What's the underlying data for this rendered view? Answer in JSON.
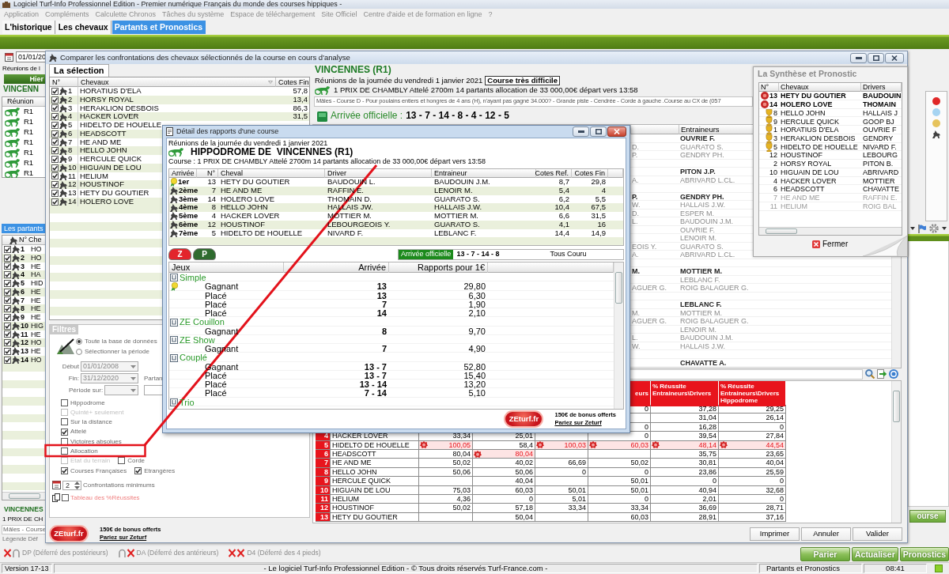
{
  "app": {
    "title": "Logiciel Turf-Info Professionnel Edition - Premier numérique Français du monde des courses hippiques -",
    "menu": [
      "Application",
      "Compléments",
      "Calculette Chronos",
      "Tâches du système",
      "Espace de téléchargement",
      "Site Officiel",
      "Centre d'aide et de formation en ligne",
      "?"
    ],
    "tabs": [
      {
        "label": "L'historique",
        "selected": false
      },
      {
        "label": "Les chevaux",
        "selected": false
      },
      {
        "label": "Partants et Pronostics",
        "selected": true
      }
    ]
  },
  "left_panel": {
    "date": "01/01/20",
    "meetings_label": "Réunions de l",
    "day_button": "Hier",
    "venue": "VINCENN",
    "meetings_column": "Réunion",
    "meetings": [
      "R1",
      "R1",
      "R1",
      "R1",
      "R1",
      "R1",
      "R1"
    ],
    "runners_tab": "Les partants",
    "runners_columns": [
      "N°",
      "Che"
    ],
    "runners": [
      {
        "number": "1",
        "name": "HO",
        "checked": true
      },
      {
        "number": "2",
        "name": "HO",
        "checked": true
      },
      {
        "number": "3",
        "name": "HE",
        "checked": true
      },
      {
        "number": "4",
        "name": "HA",
        "checked": true
      },
      {
        "number": "5",
        "name": "HID",
        "checked": true
      },
      {
        "number": "6",
        "name": "HE",
        "checked": true
      },
      {
        "number": "7",
        "name": "HE",
        "checked": true
      },
      {
        "number": "8",
        "name": "HE",
        "checked": true
      },
      {
        "number": "9",
        "name": "HE",
        "checked": true
      },
      {
        "number": "10",
        "name": "HIG",
        "checked": true
      },
      {
        "number": "11",
        "name": "HE",
        "checked": true
      },
      {
        "number": "12",
        "name": "HO",
        "checked": true
      },
      {
        "number": "13",
        "name": "HE",
        "checked": true
      },
      {
        "number": "14",
        "name": "HO",
        "checked": true
      }
    ],
    "race_venue": "VINCENNES",
    "race_title": "1 PRIX DE CH",
    "race_conditions": "Mâles - Course",
    "legend_title": "Légende Déf",
    "legend": [
      {
        "kind": "hind",
        "label": "DP (Déferré des postérieurs)"
      },
      {
        "kind": "front",
        "label": "DA (Déferré des antérieurs)"
      },
      {
        "kind": "all",
        "label": "D4 (Déferré des 4 pieds)"
      }
    ]
  },
  "right_strip": {
    "indicators": [
      {
        "color": "#e02828"
      },
      {
        "color": "#a6d4f2"
      },
      {
        "color": "#e6c35c"
      }
    ],
    "side_button": "ourse",
    "actions": [
      "Parier",
      "Actualiser",
      "Pronostics"
    ]
  },
  "status_bar": {
    "version": "Version 17-13",
    "copyright": "- Le logiciel Turf-Info Professionnel Edition - © Tous droits réservés Turf-France.com -",
    "section": "Partants et Pronostics",
    "time": "08:41"
  },
  "compare_window": {
    "title": "Comparer les confrontations des chevaux sélectionnés de la course en cours d'analyse",
    "selection_tab": "La sélection",
    "selection_columns": [
      "N°",
      "Chevaux",
      "Cotes Fin"
    ],
    "selection": [
      {
        "number": "1",
        "name": "HORATIUS D'ELA",
        "odds": "57,8",
        "checked": true
      },
      {
        "number": "2",
        "name": "HORSY ROYAL",
        "odds": "13,4",
        "checked": true
      },
      {
        "number": "3",
        "name": "HERAKLION DESBOIS",
        "odds": "86,3",
        "checked": true
      },
      {
        "number": "4",
        "name": "HACKER LOVER",
        "odds": "31,5",
        "checked": true
      },
      {
        "number": "5",
        "name": "HIDELTO DE HOUELLE",
        "checked": true
      },
      {
        "number": "6",
        "name": "HEADSCOTT",
        "checked": true
      },
      {
        "number": "7",
        "name": "HE AND ME",
        "checked": true
      },
      {
        "number": "8",
        "name": "HELLO JOHN",
        "checked": true
      },
      {
        "number": "9",
        "name": "HERCULE QUICK",
        "checked": true
      },
      {
        "number": "10",
        "name": "HIGUAIN DE LOU",
        "checked": true
      },
      {
        "number": "11",
        "name": "HELIUM",
        "checked": true
      },
      {
        "number": "12",
        "name": "HOUSTINOF",
        "checked": true
      },
      {
        "number": "13",
        "name": "HETY DU GOUTIER",
        "checked": true
      },
      {
        "number": "14",
        "name": "HOLERO LOVE",
        "checked": true
      }
    ],
    "filters": {
      "title": "Filtres",
      "scope": [
        {
          "label": "Toute la base de données",
          "selected": true
        },
        {
          "label": "Sélectionner la période",
          "selected": false
        }
      ],
      "start_label": "Début",
      "start": "01/01/2008",
      "end_label": "Fin:",
      "end": "31/12/2020",
      "side_label": "Partan",
      "period_label": "Période sur:",
      "option_rows": [
        [
          {
            "label": "Hippodrome",
            "checked": false,
            "disabled": false
          }
        ],
        [
          {
            "label": "Quinté+ seulement",
            "checked": false,
            "disabled": true
          }
        ],
        [
          {
            "label": "Sur la distance",
            "checked": false,
            "disabled": false
          }
        ],
        [
          {
            "label": "Attelé",
            "checked": true,
            "disabled": false
          }
        ],
        [
          {
            "label": "Victoires absolues",
            "checked": false,
            "disabled": false
          }
        ],
        [
          {
            "label": "Allocation",
            "checked": false,
            "disabled": false
          }
        ],
        [
          {
            "label": "Etat du terrain",
            "checked": false,
            "disabled": true
          },
          {
            "label": "Corde",
            "checked": false,
            "disabled": false
          }
        ],
        [
          {
            "label": "Courses Françaises",
            "checked": true,
            "disabled": false
          },
          {
            "label": "Etrangères",
            "checked": true,
            "disabled": false
          }
        ]
      ],
      "min_count": "2",
      "min_label": "Confrontations minimums",
      "table_option": {
        "label": "Tableau des %Réussites",
        "checked": false
      }
    },
    "race": {
      "venue": "VINCENNES (R1)",
      "date_line": "Réunions de la journée du vendredi 1 janvier 2021",
      "difficulty": "Course très difficile",
      "title": "1 PRIX DE CHAMBLY Attelé 2700m 14 partants allocation de 33 000,00€ départ vers 13:58",
      "conditions": "Mâles - Course D - Pour poulains entiers et hongres de 4 ans (H), n'ayant pas gagné 34.000? - Grande piste - Cendrée - Corde à gauche .Course au CX de (057",
      "result_label": "Arrivée officielle :",
      "result": "13 - 7 - 14 - 8 - 4 - 12 - 5"
    },
    "trainers_column": "Entraineurs",
    "trainers": [
      {
        "kind": "lead",
        "trainer": "OUVRIE F."
      },
      {
        "kind": "member",
        "driver": "D.",
        "trainer": "GUARATO S."
      },
      {
        "kind": "member",
        "driver": "P.",
        "trainer": "GENDRY PH."
      },
      {
        "kind": "spacer"
      },
      {
        "kind": "lead",
        "trainer": "PITON J.P."
      },
      {
        "kind": "member",
        "driver": "A.",
        "trainer": "ABRIVARD L.CL."
      },
      {
        "kind": "spacer"
      },
      {
        "kind": "lead",
        "driver": "P.",
        "trainer": "GENDRY PH."
      },
      {
        "kind": "member",
        "driver": "W.",
        "trainer": "HALLAIS J.W."
      },
      {
        "kind": "member",
        "driver": "D.",
        "trainer": "ESPER M."
      },
      {
        "kind": "member",
        "driver": "L.",
        "trainer": "BAUDOUIN J.M."
      },
      {
        "kind": "member",
        "trainer": "OUVRIE F."
      },
      {
        "kind": "member",
        "trainer": "LENOIR M."
      },
      {
        "kind": "member",
        "driver": "EOIS Y.",
        "trainer": "GUARATO S."
      },
      {
        "kind": "member",
        "driver": "A.",
        "trainer": "ABRIVARD L.CL."
      },
      {
        "kind": "spacer"
      },
      {
        "kind": "lead",
        "driver": "M.",
        "trainer": "MOTTIER M."
      },
      {
        "kind": "member",
        "trainer": "LEBLANC F."
      },
      {
        "kind": "member",
        "driver": "AGUER G.",
        "trainer": "ROIG BALAGUER G."
      },
      {
        "kind": "spacer"
      },
      {
        "kind": "lead",
        "trainer": "LEBLANC F."
      },
      {
        "kind": "member",
        "driver": "M.",
        "trainer": "MOTTIER M."
      },
      {
        "kind": "member",
        "driver": "AGUER G.",
        "trainer": "ROIG BALAGUER G."
      },
      {
        "kind": "member",
        "trainer": "LENOIR M."
      },
      {
        "kind": "member",
        "driver": "L.",
        "trainer": "BAUDOUIN J.M."
      },
      {
        "kind": "member",
        "driver": "W.",
        "trainer": "HALLAIS J.W."
      },
      {
        "kind": "spacer"
      },
      {
        "kind": "lead",
        "trainer": "CHAVATTE A."
      }
    ],
    "stats_columns": [
      "eurs",
      "% Réussite Entraineurs\\Drivers",
      "% Réussite Entraineurs\\Drivers Hippodrome"
    ],
    "stats": [
      {
        "cells": [
          {
            "text": "0",
            "flagged": false
          },
          {
            "text": "37,28",
            "flagged": false
          },
          {
            "text": "29,25",
            "flagged": false
          }
        ]
      },
      {
        "cells": [
          {
            "flagged": false
          },
          {
            "text": "31,04",
            "flagged": false
          },
          {
            "text": "26,14",
            "flagged": false
          }
        ]
      },
      {
        "cells": [
          {
            "text": "0",
            "flagged": false
          },
          {
            "text": "16,28",
            "flagged": false
          },
          {
            "text": "0",
            "flagged": false
          }
        ]
      },
      {
        "number": "4",
        "name": "HACKER LOVER",
        "cells": [
          {
            "text": "33,34",
            "flagged": false
          },
          {
            "text": "25,01",
            "flagged": false
          },
          {
            "flagged": false
          },
          {
            "text": "0",
            "flagged": false
          },
          {
            "text": "39,54",
            "flagged": false
          },
          {
            "text": "27,84",
            "flagged": false
          }
        ]
      },
      {
        "number": "5",
        "name": "HIDELTO DE HOUELLE",
        "cells": [
          {
            "text": "100,05",
            "flagged": true
          },
          {
            "text": "58,4",
            "flagged": false
          },
          {
            "text": "100,03",
            "flagged": true
          },
          {
            "text": "60,03",
            "flagged": true
          },
          {
            "text": "48,14",
            "flagged": true
          },
          {
            "text": "44,54",
            "flagged": true
          }
        ]
      },
      {
        "number": "6",
        "name": "HEADSCOTT",
        "cells": [
          {
            "text": "80,04",
            "flagged": false
          },
          {
            "text": "80,04",
            "flagged": true
          },
          {
            "flagged": false
          },
          {
            "flagged": false
          },
          {
            "text": "35,75",
            "flagged": false
          },
          {
            "text": "23,65",
            "flagged": false
          }
        ]
      },
      {
        "number": "7",
        "name": "HE AND ME",
        "cells": [
          {
            "text": "50,02",
            "flagged": false
          },
          {
            "text": "40,02",
            "flagged": false
          },
          {
            "text": "66,69",
            "flagged": false
          },
          {
            "text": "50,02",
            "flagged": false
          },
          {
            "text": "30,81",
            "flagged": false
          },
          {
            "text": "40,04",
            "flagged": false
          }
        ]
      },
      {
        "number": "8",
        "name": "HELLO JOHN",
        "cells": [
          {
            "text": "50,06",
            "flagged": false
          },
          {
            "text": "50,06",
            "flagged": false
          },
          {
            "text": "0",
            "flagged": false
          },
          {
            "text": "0",
            "flagged": false
          },
          {
            "text": "23,86",
            "flagged": false
          },
          {
            "text": "25,59",
            "flagged": false
          }
        ]
      },
      {
        "number": "9",
        "name": "HERCULE QUICK",
        "cells": [
          {
            "flagged": false
          },
          {
            "text": "40,04",
            "flagged": false
          },
          {
            "flagged": false
          },
          {
            "text": "50,01",
            "flagged": false
          },
          {
            "text": "0",
            "flagged": false
          },
          {
            "text": "0",
            "flagged": false
          }
        ]
      },
      {
        "number": "10",
        "name": "HIGUAIN DE LOU",
        "cells": [
          {
            "text": "75,03",
            "flagged": false
          },
          {
            "text": "60,03",
            "flagged": false
          },
          {
            "text": "50,01",
            "flagged": false
          },
          {
            "text": "50,01",
            "flagged": false
          },
          {
            "text": "40,94",
            "flagged": false
          },
          {
            "text": "32,68",
            "flagged": false
          }
        ]
      },
      {
        "number": "11",
        "name": "HELIUM",
        "cells": [
          {
            "text": "4,36",
            "flagged": false
          },
          {
            "text": "0",
            "flagged": false
          },
          {
            "text": "5,01",
            "flagged": false
          },
          {
            "text": "0",
            "flagged": false
          },
          {
            "text": "2,01",
            "flagged": false
          },
          {
            "text": "0",
            "flagged": false
          }
        ]
      },
      {
        "number": "12",
        "name": "HOUSTINOF",
        "cells": [
          {
            "text": "50,02",
            "flagged": false
          },
          {
            "text": "57,18",
            "flagged": false
          },
          {
            "text": "33,34",
            "flagged": false
          },
          {
            "text": "33,34",
            "flagged": false
          },
          {
            "text": "36,69",
            "flagged": false
          },
          {
            "text": "28,71",
            "flagged": false
          }
        ]
      },
      {
        "number": "13",
        "name": "HETY DU GOUTIER",
        "cells": [
          {
            "flagged": false
          },
          {
            "text": "50,04",
            "flagged": false
          },
          {
            "flagged": false
          },
          {
            "text": "60,03",
            "flagged": false
          },
          {
            "text": "28,91",
            "flagged": false
          },
          {
            "text": "37,16",
            "flagged": false
          }
        ]
      }
    ],
    "ad": {
      "logo": "ZEturf.fr",
      "offer": "150€ de bonus offerts",
      "link": "Pariez sur Zeturf"
    },
    "buttons": [
      "Imprimer",
      "Annuler",
      "Valider"
    ]
  },
  "detail_window": {
    "title": "Détail des rapports d'une course",
    "date_line": "Réunions de la journée du vendredi 1 janvier 2021",
    "venue": "HIPPODROME DE  VINCENNES (R1)",
    "course": "Course : 1 PRIX DE CHAMBLY Attelé 2700m 14 partants allocation de 33 000,00€ départ vers 13:58",
    "columns": [
      "Arrivée",
      "N°",
      "Cheval",
      "Driver",
      "Entraineur",
      "Cotes Ref.",
      "Cotes Fin"
    ],
    "finishers": [
      {
        "place": "1er",
        "kind": "winner",
        "number": "13",
        "horse": "HETY DU GOUTIER",
        "driver": "BAUDOUIN L.",
        "trainer": "BAUDOUIN J.M.",
        "odds_ref": "8,7",
        "odds_final": "29,8"
      },
      {
        "place": "2ème",
        "kind": "placed",
        "number": "7",
        "horse": "HE AND ME",
        "driver": "RAFFIN E.",
        "trainer": "LENOIR M.",
        "odds_ref": "5,4",
        "odds_final": "4"
      },
      {
        "place": "3ème",
        "kind": "placed",
        "number": "14",
        "horse": "HOLERO LOVE",
        "driver": "THOMAIN D.",
        "trainer": "GUARATO S.",
        "odds_ref": "6,2",
        "odds_final": "5,5"
      },
      {
        "place": "4ème",
        "kind": "placed",
        "number": "8",
        "horse": "HELLO JOHN",
        "driver": "HALLAIS JW.",
        "trainer": "HALLAIS J.W.",
        "odds_ref": "10,4",
        "odds_final": "67,5"
      },
      {
        "place": "5ème",
        "kind": "placed",
        "number": "4",
        "horse": "HACKER LOVER",
        "driver": "MOTTIER M.",
        "trainer": "MOTTIER M.",
        "odds_ref": "6,6",
        "odds_final": "31,5"
      },
      {
        "place": "6ème",
        "kind": "placed",
        "number": "12",
        "horse": "HOUSTINOF",
        "driver": "LEBOURGEOIS Y.",
        "trainer": "GUARATO S.",
        "odds_ref": "4,1",
        "odds_final": "16"
      },
      {
        "place": "7ème",
        "kind": "placed",
        "number": "5",
        "horse": "HIDELTO DE HOUELLE",
        "driver": "NIVARD F.",
        "trainer": "LEBLANC F.",
        "odds_ref": "14,4",
        "odds_final": "14,9"
      }
    ],
    "sources": [
      {
        "label": "Z",
        "color": "#e3242b"
      },
      {
        "label": "P",
        "color": "#2e6b2e"
      }
    ],
    "result_label": "Arrivée officielle",
    "result": "13 - 7 - 14 - 8",
    "status": "Tous Couru",
    "bets_columns": [
      "Jeux",
      "Arrivée",
      "Rapports pour 1€"
    ],
    "bets": [
      {
        "name": "Simple",
        "children": [
          {
            "name": "Gagnant",
            "arrival": "13",
            "payout": "29,80",
            "marked": true
          },
          {
            "name": "Placé",
            "arrival": "13",
            "payout": "6,30",
            "marked": false
          },
          {
            "name": "Placé",
            "arrival": "7",
            "payout": "1,90",
            "marked": false
          },
          {
            "name": "Placé",
            "arrival": "14",
            "payout": "2,10",
            "marked": false
          }
        ]
      },
      {
        "name": "ZE Couillon",
        "children": [
          {
            "name": "Gagnant",
            "arrival": "8",
            "payout": "9,70",
            "marked": false
          }
        ]
      },
      {
        "name": "ZE Show",
        "children": [
          {
            "name": "Gagnant",
            "arrival": "7",
            "payout": "4,90",
            "marked": false
          }
        ]
      },
      {
        "name": "Couplé",
        "children": [
          {
            "name": "Gagnant",
            "arrival": "13 - 7",
            "payout": "52,80",
            "marked": false
          },
          {
            "name": "Placé",
            "arrival": "13 - 7",
            "payout": "15,40",
            "marked": false
          },
          {
            "name": "Placé",
            "arrival": "13 - 14",
            "payout": "13,20",
            "marked": false
          },
          {
            "name": "Placé",
            "arrival": "7 - 14",
            "payout": "5,10",
            "marked": false
          }
        ]
      },
      {
        "name": "Trio"
      }
    ],
    "ad": {
      "logo": "ZEturf.fr",
      "offer": "150€ de bonus offerts",
      "link": "Pariez sur Zeturf"
    }
  },
  "synthesis_window": {
    "title": "La Synthèse et Pronostic",
    "columns": [
      "N°",
      "Chevaux",
      "Drivers"
    ],
    "rows": [
      {
        "kind": "top",
        "number": "13",
        "horse": "HETY DU GOUTIER",
        "driver": "BAUDOUIN"
      },
      {
        "kind": "top",
        "number": "14",
        "horse": "HOLERO LOVE",
        "driver": "THOMAIN"
      },
      {
        "kind": "trophy",
        "number": "8",
        "horse": "HELLO JOHN",
        "driver": "HALLAIS J"
      },
      {
        "kind": "trophy",
        "number": "9",
        "horse": "HERCULE QUICK",
        "driver": "GOOP BJ"
      },
      {
        "kind": "trophy",
        "number": "1",
        "horse": "HORATIUS D'ELA",
        "driver": "OUVRIE F"
      },
      {
        "kind": "trophy",
        "number": "3",
        "horse": "HERAKLION DESBOIS",
        "driver": "GENDRY"
      },
      {
        "kind": "trophy",
        "number": "5",
        "horse": "HIDELTO DE HOUELLE",
        "driver": "NIVARD F."
      },
      {
        "kind": "plain",
        "number": "12",
        "horse": "HOUSTINOF",
        "driver": "LEBOURG"
      },
      {
        "kind": "plain",
        "number": "2",
        "horse": "HORSY ROYAL",
        "driver": "PITON B."
      },
      {
        "kind": "plain",
        "number": "10",
        "horse": "HIGUAIN DE LOU",
        "driver": "ABRIVARD"
      },
      {
        "kind": "plain",
        "number": "4",
        "horse": "HACKER LOVER",
        "driver": "MOTTIER"
      },
      {
        "kind": "plain",
        "number": "6",
        "horse": "HEADSCOTT",
        "driver": "CHAVATTE"
      },
      {
        "kind": "out",
        "number": "7",
        "horse": "HE AND ME",
        "driver": "RAFFIN E."
      },
      {
        "kind": "out",
        "number": "11",
        "horse": "HELIUM",
        "driver": "ROIG BAL"
      }
    ],
    "close": "Fermer"
  }
}
